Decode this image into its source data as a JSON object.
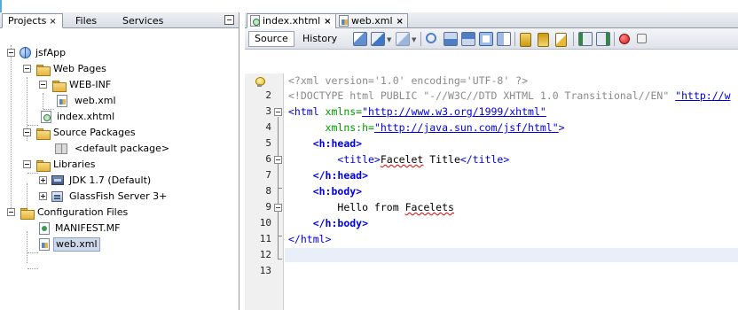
{
  "left_panel": {
    "tabs": [
      {
        "label": "Projects",
        "close": "×"
      },
      {
        "label": "Files"
      },
      {
        "label": "Services"
      }
    ],
    "tree": {
      "project": "jsfApp",
      "web_pages": "Web Pages",
      "web_inf": "WEB-INF",
      "web_xml_inner": "web.xml",
      "index_xhtml": "index.xhtml",
      "source_packages": "Source Packages",
      "default_package": "<default package>",
      "libraries": "Libraries",
      "jdk": "JDK 1.7 (Default)",
      "glassfish": "GlassFish Server 3+",
      "configuration_files": "Configuration Files",
      "manifest": "MANIFEST.MF",
      "web_xml_selected": "web.xml"
    }
  },
  "editor": {
    "tabs": [
      {
        "label": "index.xhtml",
        "close": "×"
      },
      {
        "label": "web.xml",
        "close": "×"
      }
    ],
    "view_buttons": {
      "source": "Source",
      "history": "History"
    },
    "toolbar_icons": [
      "last-edit-icon",
      "back-icon",
      "forward-icon",
      "find-icon",
      "find-previous-icon",
      "find-next-icon",
      "toggle-highlight-icon",
      "toggle-rectangular-icon",
      "previous-bookmark-icon",
      "next-bookmark-icon",
      "toggle-bookmark-icon",
      "shift-left-icon",
      "shift-right-icon",
      "start-macro-icon",
      "stop-macro-icon"
    ],
    "line_numbers": [
      "2",
      "3",
      "4",
      "5",
      "6",
      "7",
      "8",
      "9",
      "10",
      "11",
      "12",
      "13"
    ],
    "code": {
      "l1": "<?xml version='1.0' encoding='UTF-8' ?>",
      "l2": "<!DOCTYPE html PUBLIC \"-//W3C//DTD XHTML 1.0 Transitional//EN\" ",
      "l2_url": "\"http://w",
      "l3_open": "<html ",
      "l3_attr": "xmlns=",
      "l3_val": "\"http://www.w3.org/1999/xhtml\"",
      "l4_attr": "xmlns:h=",
      "l4_val": "\"http://java.sun.com/jsf/html\"",
      "l4_close": ">",
      "l5": "<h:head>",
      "l6_open": "<title>",
      "l6_word1": "Facelet",
      "l6_word2": " Title",
      "l6_close": "</title>",
      "l7": "</h:head>",
      "l8": "<h:body>",
      "l9_text": "Hello from ",
      "l9_word": "Facelets",
      "l10": "</h:body>",
      "l11": "</html>"
    }
  }
}
